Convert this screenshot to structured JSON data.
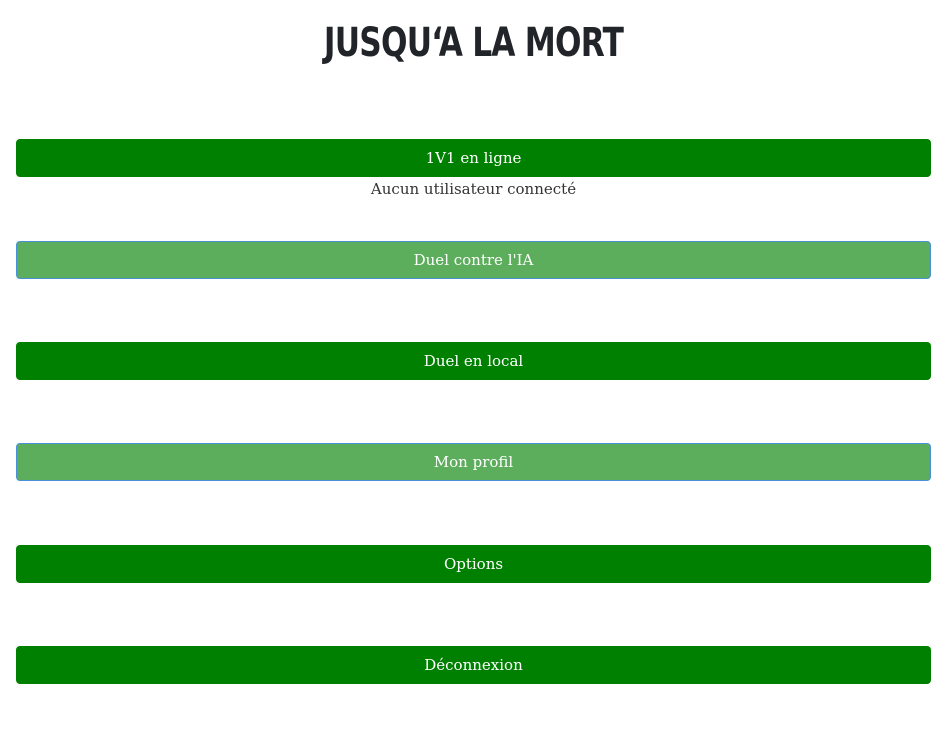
{
  "title": "JUSQU‘A LA MORT",
  "menu": {
    "online": "1V1 en ligne",
    "online_status": "Aucun utilisateur connecté",
    "vs_ai": "Duel contre l'IA",
    "local": "Duel en local",
    "profile": "Mon profil",
    "options": "Options",
    "logout": "Déconnexion"
  },
  "colors": {
    "button_primary": "#008000",
    "button_light": "#5cad5c",
    "button_light_border": "#4a90d9",
    "title_text": "#212529"
  }
}
